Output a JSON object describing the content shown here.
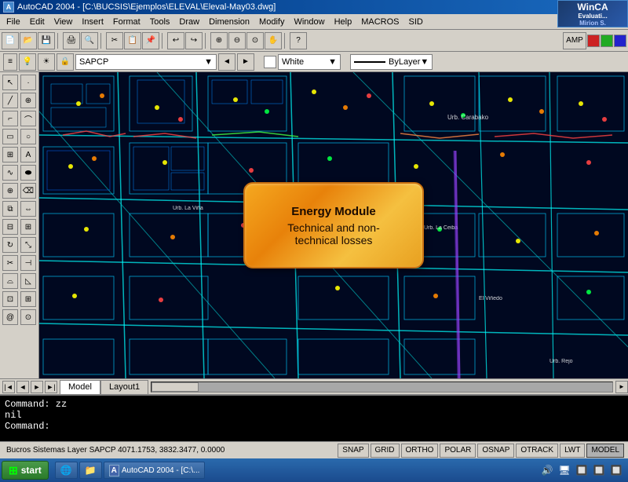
{
  "titlebar": {
    "title": "AutoCAD 2004 - [C:\\BUCSIS\\Ejemplos\\ELEVAL\\Eleval-May03.dwg]",
    "app_icon": "A",
    "wineval_line1": "WinCA",
    "wineval_line2": "Evaluati...",
    "mirion_label": "Mirion S."
  },
  "menubar": {
    "items": [
      "File",
      "Edit",
      "View",
      "Insert",
      "Format",
      "Tools",
      "Draw",
      "Dimension",
      "Modify",
      "Window",
      "Help",
      "MACROS",
      "SID"
    ]
  },
  "toolbar2": {
    "layer": "SAPCP",
    "color": "White",
    "linetype": "ByLayer"
  },
  "tabs": {
    "model": "Model",
    "layout1": "Layout1"
  },
  "energy_module": {
    "line1": "Energy Module",
    "line2": "Technical and non-",
    "line3": "technical losses"
  },
  "command_window": {
    "lines": [
      "Command: zz",
      "nil",
      "Command:"
    ]
  },
  "statusbar": {
    "info": "Bucros Sistemas Layer SAPCP  4071.1753, 3832.3477, 0.0000",
    "snap": "SNAP",
    "grid": "GRID",
    "ortho": "ORTHO",
    "polar": "POLAR",
    "osnap": "OSNAP",
    "otrack": "OTRACK",
    "lwt": "LWT",
    "model": "MODEL"
  },
  "taskbar": {
    "start": "start",
    "autocad_btn": "AutoCAD 2004 - [C:\\..."
  }
}
